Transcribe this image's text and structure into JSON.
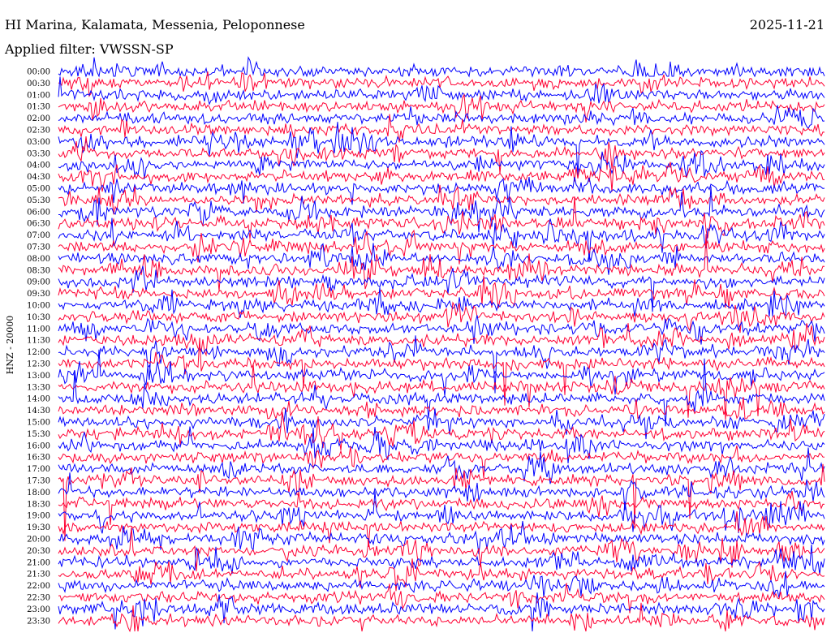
{
  "header": {
    "station": "HI Marina, Kalamata, Messenia, Peloponnese",
    "date": "2025-11-21",
    "filter": "Applied filter: VWSSN-SP"
  },
  "chart_data": {
    "type": "line",
    "title": "HI Marina, Kalamata, Messenia, Peloponnese",
    "ylabel": "HNZ - 20000",
    "row_labels": [
      "00:00",
      "00:30",
      "01:00",
      "01:30",
      "02:00",
      "02:30",
      "03:00",
      "03:30",
      "04:00",
      "04:30",
      "05:00",
      "05:30",
      "06:00",
      "06:30",
      "07:00",
      "07:30",
      "08:00",
      "08:30",
      "09:00",
      "09:30",
      "10:00",
      "10:30",
      "11:00",
      "11:30",
      "12:00",
      "12:30",
      "13:00",
      "13:30",
      "14:00",
      "14:30",
      "15:00",
      "15:30",
      "16:00",
      "16:30",
      "17:00",
      "17:30",
      "18:00",
      "18:30",
      "19:00",
      "19:30",
      "20:00",
      "20:30",
      "21:00",
      "21:30",
      "22:00",
      "22:30",
      "23:00",
      "23:30"
    ],
    "series": [
      {
        "color": "#0000ff"
      },
      {
        "color": "#ff0033"
      }
    ],
    "colors": {
      "blue": "#0000ff",
      "red": "#ff0033",
      "text": "#000000"
    },
    "grid": false
  }
}
